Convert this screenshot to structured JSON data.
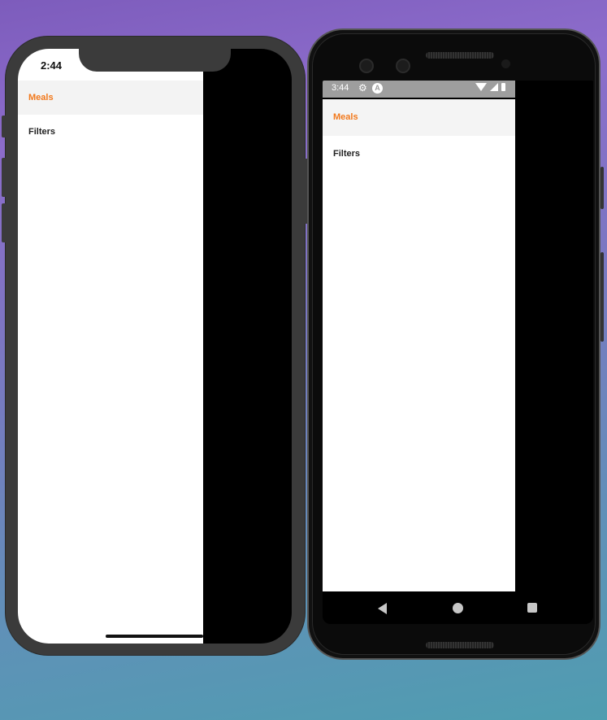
{
  "ios": {
    "status_time": "2:44",
    "drawer_items": [
      {
        "label": "Meals",
        "active": true
      },
      {
        "label": "Filters",
        "active": false
      }
    ]
  },
  "android": {
    "status_time": "3:44",
    "status_icons": [
      "gear-icon",
      "a-badge-icon",
      "wifi-icon",
      "signal-icon",
      "battery-icon"
    ],
    "drawer_items": [
      {
        "label": "Meals",
        "active": true
      },
      {
        "label": "Filters",
        "active": false
      }
    ],
    "nav_buttons": [
      "back-icon",
      "home-icon",
      "recents-icon"
    ]
  },
  "colors": {
    "active_item": "#f2791c",
    "active_bg": "#f3f3f3",
    "inactive_item": "#222222",
    "android_status_bar": "#9e9e9e"
  }
}
